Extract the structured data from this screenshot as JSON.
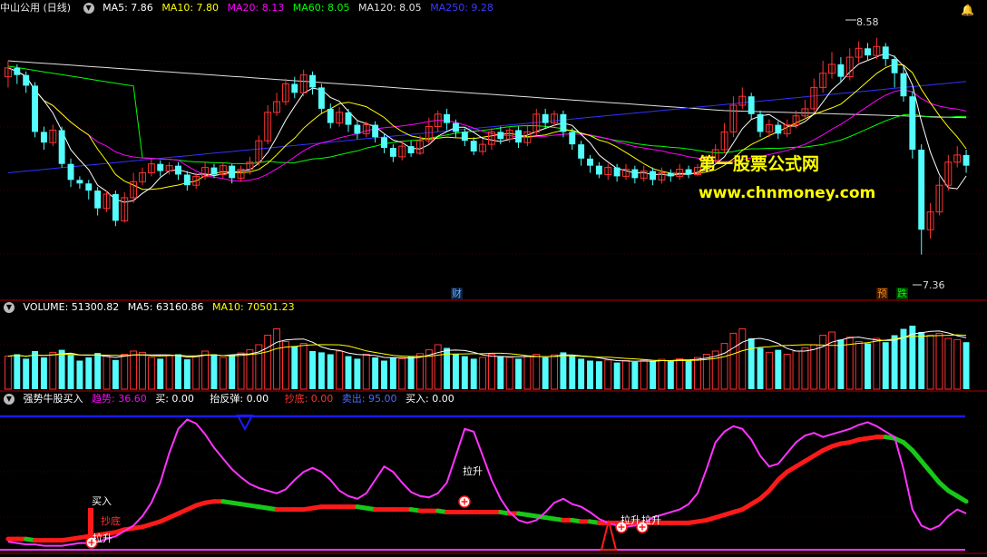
{
  "header": {
    "title": "中山公用 (日线)",
    "ma5": "MA5: 7.86",
    "ma10": "MA10: 7.80",
    "ma20": "MA20: 8.13",
    "ma60": "MA60: 8.05",
    "ma120": "MA120: 8.05",
    "ma250": "MA250: 9.28"
  },
  "volume_header": {
    "title": "VOLUME: 51300.82",
    "ma5": "MA5: 63160.86",
    "ma10": "MA10: 70501.23"
  },
  "indicator_header": {
    "title": "强势牛股买入",
    "trend": "趋势: 36.60",
    "buy": "买: 0.00",
    "rebound": "抬反弹: 0.00",
    "bottom": "抄底: 0.00",
    "sell": "卖出: 95.00",
    "buy2": "买入: 0.00"
  },
  "watermark": {
    "line1": "第一股票公式网",
    "line2": "www.chnmoney.com"
  },
  "markers": {
    "cai": "财",
    "yu": "预",
    "die": "跌",
    "high": "8.58",
    "low": "7.36"
  },
  "indicator_labels": {
    "buy_in": "买入",
    "chaodi": "抄底",
    "lasheng": "拉升"
  },
  "colors": {
    "up": "#ff3232",
    "down": "#54fcfc",
    "ma5": "#ffffff",
    "ma10": "#ffff00",
    "ma20": "#ff00ff",
    "ma60": "#00ff00",
    "ma120": "#e0e0e0",
    "ma250": "#3232ff",
    "separator": "#b00000"
  },
  "chart_data": [
    {
      "type": "candlestick",
      "title": "中山公用 (日线)",
      "ylim": [
        7.2,
        8.7
      ],
      "extremes": {
        "high": 8.58,
        "low": 7.36
      },
      "candles": [
        [
          8.36,
          8.41,
          8.3,
          8.45
        ],
        [
          8.41,
          8.37,
          8.32,
          8.43
        ],
        [
          8.37,
          8.31,
          8.27,
          8.39
        ],
        [
          8.31,
          8.05,
          8.02,
          8.33
        ],
        [
          8.05,
          7.99,
          7.95,
          8.08
        ],
        [
          7.99,
          8.06,
          7.97,
          8.09
        ],
        [
          8.06,
          7.87,
          7.85,
          8.08
        ],
        [
          7.87,
          7.78,
          7.74,
          7.9
        ],
        [
          7.78,
          7.76,
          7.73,
          7.8
        ],
        [
          7.76,
          7.72,
          7.67,
          7.78
        ],
        [
          7.72,
          7.62,
          7.58,
          7.74
        ],
        [
          7.62,
          7.7,
          7.6,
          7.72
        ],
        [
          7.7,
          7.55,
          7.52,
          7.72
        ],
        [
          7.55,
          7.68,
          7.54,
          7.71
        ],
        [
          7.68,
          7.77,
          7.65,
          7.82
        ],
        [
          7.77,
          7.82,
          7.75,
          7.85
        ],
        [
          7.82,
          7.87,
          7.8,
          7.9
        ],
        [
          7.87,
          7.83,
          7.8,
          7.89
        ],
        [
          7.83,
          7.86,
          7.81,
          7.88
        ],
        [
          7.86,
          7.81,
          7.78,
          7.88
        ],
        [
          7.81,
          7.75,
          7.72,
          7.83
        ],
        [
          7.75,
          7.8,
          7.73,
          7.82
        ],
        [
          7.8,
          7.85,
          7.78,
          7.88
        ],
        [
          7.85,
          7.81,
          7.79,
          7.87
        ],
        [
          7.81,
          7.86,
          7.79,
          7.88
        ],
        [
          7.86,
          7.79,
          7.76,
          7.87
        ],
        [
          7.79,
          7.84,
          7.77,
          7.86
        ],
        [
          7.84,
          7.88,
          7.81,
          7.91
        ],
        [
          7.88,
          8.0,
          7.86,
          8.03
        ],
        [
          8.0,
          8.16,
          7.98,
          8.2
        ],
        [
          8.16,
          8.22,
          8.14,
          8.27
        ],
        [
          8.22,
          8.32,
          8.2,
          8.35
        ],
        [
          8.32,
          8.27,
          8.24,
          8.36
        ],
        [
          8.27,
          8.37,
          8.25,
          8.4
        ],
        [
          8.37,
          8.3,
          8.26,
          8.39
        ],
        [
          8.3,
          8.18,
          8.15,
          8.32
        ],
        [
          8.18,
          8.1,
          8.07,
          8.21
        ],
        [
          8.1,
          8.16,
          8.08,
          8.19
        ],
        [
          8.16,
          8.09,
          8.05,
          8.18
        ],
        [
          8.09,
          8.04,
          8.01,
          8.11
        ],
        [
          8.04,
          8.09,
          8.02,
          8.11
        ],
        [
          8.09,
          8.02,
          7.99,
          8.11
        ],
        [
          8.02,
          7.96,
          7.93,
          8.04
        ],
        [
          7.96,
          7.91,
          7.88,
          7.98
        ],
        [
          7.91,
          7.97,
          7.89,
          8.0
        ],
        [
          7.97,
          7.93,
          7.91,
          8.0
        ],
        [
          7.93,
          8.0,
          7.92,
          8.03
        ],
        [
          8.0,
          8.08,
          7.98,
          8.13
        ],
        [
          8.08,
          8.15,
          8.05,
          8.17
        ],
        [
          8.15,
          8.1,
          8.06,
          8.18
        ],
        [
          8.1,
          8.05,
          8.02,
          8.12
        ],
        [
          8.05,
          8.0,
          7.97,
          8.07
        ],
        [
          8.0,
          7.94,
          7.92,
          8.02
        ],
        [
          7.94,
          7.98,
          7.92,
          8.01
        ],
        [
          7.98,
          8.05,
          7.95,
          8.07
        ],
        [
          8.05,
          8.01,
          7.98,
          8.08
        ],
        [
          8.01,
          8.06,
          7.99,
          8.08
        ],
        [
          8.06,
          7.99,
          7.96,
          8.08
        ],
        [
          7.99,
          8.05,
          7.97,
          8.09
        ],
        [
          8.05,
          8.15,
          8.03,
          8.18
        ],
        [
          8.15,
          8.1,
          8.07,
          8.18
        ],
        [
          8.1,
          8.15,
          8.08,
          8.17
        ],
        [
          8.15,
          8.05,
          8.02,
          8.17
        ],
        [
          8.05,
          7.98,
          7.95,
          8.07
        ],
        [
          7.98,
          7.9,
          7.86,
          8.0
        ],
        [
          7.9,
          7.86,
          7.82,
          7.92
        ],
        [
          7.86,
          7.81,
          7.79,
          7.88
        ],
        [
          7.81,
          7.85,
          7.78,
          7.87
        ],
        [
          7.85,
          7.8,
          7.77,
          7.87
        ],
        [
          7.8,
          7.84,
          7.78,
          7.87
        ],
        [
          7.84,
          7.79,
          7.76,
          7.86
        ],
        [
          7.79,
          7.83,
          7.77,
          7.86
        ],
        [
          7.83,
          7.78,
          7.75,
          7.85
        ],
        [
          7.78,
          7.82,
          7.76,
          7.85
        ],
        [
          7.82,
          7.8,
          7.77,
          7.84
        ],
        [
          7.8,
          7.84,
          7.78,
          7.87
        ],
        [
          7.84,
          7.81,
          7.79,
          7.86
        ],
        [
          7.81,
          7.85,
          7.8,
          7.87
        ],
        [
          7.85,
          7.89,
          7.83,
          7.92
        ],
        [
          7.89,
          7.95,
          7.87,
          7.98
        ],
        [
          7.95,
          8.05,
          7.93,
          8.1
        ],
        [
          8.05,
          8.2,
          8.02,
          8.25
        ],
        [
          8.2,
          8.25,
          8.18,
          8.3
        ],
        [
          8.25,
          8.15,
          8.12,
          8.27
        ],
        [
          8.15,
          8.05,
          8.02,
          8.17
        ],
        [
          8.05,
          8.09,
          8.02,
          8.12
        ],
        [
          8.09,
          8.04,
          8.01,
          8.11
        ],
        [
          8.04,
          8.09,
          8.02,
          8.12
        ],
        [
          8.09,
          8.14,
          8.07,
          8.17
        ],
        [
          8.14,
          8.18,
          8.12,
          8.23
        ],
        [
          8.18,
          8.3,
          8.16,
          8.35
        ],
        [
          8.3,
          8.38,
          8.27,
          8.45
        ],
        [
          8.38,
          8.43,
          8.35,
          8.5
        ],
        [
          8.43,
          8.36,
          8.33,
          8.47
        ],
        [
          8.36,
          8.47,
          8.34,
          8.52
        ],
        [
          8.47,
          8.52,
          8.44,
          8.56
        ],
        [
          8.52,
          8.48,
          8.45,
          8.55
        ],
        [
          8.48,
          8.53,
          8.46,
          8.58
        ],
        [
          8.53,
          8.46,
          8.42,
          8.55
        ],
        [
          8.46,
          8.38,
          8.3,
          8.48
        ],
        [
          8.38,
          8.25,
          8.22,
          8.42
        ],
        [
          8.25,
          7.95,
          7.9,
          8.28
        ],
        [
          7.95,
          7.5,
          7.36,
          7.98
        ],
        [
          7.5,
          7.6,
          7.45,
          7.65
        ],
        [
          7.6,
          7.75,
          7.58,
          7.8
        ],
        [
          7.75,
          7.88,
          7.72,
          7.92
        ],
        [
          7.88,
          7.92,
          7.85,
          7.97
        ],
        [
          7.92,
          7.86,
          7.82,
          7.95
        ]
      ],
      "ma_series": [
        "MA5",
        "MA10",
        "MA20",
        "MA60",
        "MA120",
        "MA250"
      ]
    },
    {
      "type": "bar",
      "title": "VOLUME",
      "values": [
        52,
        55,
        48,
        60,
        50,
        58,
        62,
        54,
        45,
        50,
        57,
        52,
        46,
        55,
        60,
        58,
        50,
        48,
        53,
        55,
        47,
        52,
        60,
        55,
        50,
        54,
        57,
        62,
        70,
        85,
        95,
        75,
        68,
        72,
        60,
        58,
        55,
        60,
        52,
        48,
        55,
        50,
        45,
        50,
        48,
        52,
        56,
        62,
        70,
        65,
        55,
        52,
        48,
        50,
        55,
        52,
        50,
        48,
        52,
        55,
        50,
        54,
        58,
        52,
        48,
        45,
        44,
        46,
        42,
        45,
        43,
        46,
        44,
        47,
        45,
        48,
        46,
        50,
        55,
        60,
        72,
        88,
        95,
        80,
        65,
        58,
        62,
        55,
        60,
        65,
        70,
        85,
        90,
        78,
        82,
        75,
        72,
        80,
        74,
        85,
        95,
        100,
        90,
        85,
        88,
        80,
        78,
        74
      ],
      "ylim": [
        0,
        120
      ]
    },
    {
      "type": "line",
      "title": "强势牛股买入",
      "ylim": [
        0,
        100
      ],
      "series": [
        {
          "name": "趋势",
          "values": [
            6,
            5,
            4,
            4,
            3,
            3,
            3,
            4,
            5,
            5,
            6,
            8,
            10,
            14,
            18,
            25,
            35,
            50,
            72,
            90,
            97,
            94,
            86,
            76,
            68,
            60,
            54,
            49,
            46,
            44,
            42,
            45,
            52,
            58,
            61,
            58,
            52,
            44,
            40,
            38,
            42,
            52,
            62,
            58,
            50,
            43,
            40,
            39,
            42,
            50,
            70,
            90,
            88,
            70,
            52,
            38,
            28,
            22,
            20,
            22,
            28,
            35,
            38,
            34,
            32,
            28,
            23,
            20,
            18,
            17,
            18,
            20,
            24,
            26,
            28,
            30,
            34,
            42,
            60,
            80,
            88,
            92,
            90,
            82,
            70,
            62,
            64,
            72,
            80,
            85,
            87,
            84,
            86,
            88,
            90,
            93,
            95,
            92,
            88,
            84,
            60,
            30,
            18,
            15,
            18,
            25,
            30,
            27
          ]
        },
        {
          "name": "买",
          "values": [
            8,
            8,
            8,
            7,
            7,
            7,
            7,
            8,
            9,
            10,
            11,
            12,
            13,
            15,
            16,
            17,
            19,
            21,
            24,
            27,
            30,
            33,
            35,
            36,
            36,
            35,
            34,
            33,
            32,
            31,
            30,
            30,
            30,
            30,
            31,
            32,
            32,
            32,
            32,
            32,
            31,
            30,
            30,
            30,
            30,
            30,
            29,
            29,
            29,
            28,
            28,
            28,
            28,
            28,
            28,
            28,
            27,
            27,
            26,
            25,
            24,
            23,
            22,
            22,
            21,
            21,
            20,
            20,
            20,
            20,
            20,
            20,
            20,
            20,
            20,
            20,
            20,
            21,
            22,
            24,
            26,
            28,
            30,
            34,
            38,
            44,
            52,
            58,
            62,
            66,
            70,
            74,
            77,
            79,
            80,
            82,
            83,
            84,
            84,
            83,
            80,
            74,
            66,
            58,
            50,
            44,
            40,
            36
          ]
        }
      ]
    }
  ]
}
